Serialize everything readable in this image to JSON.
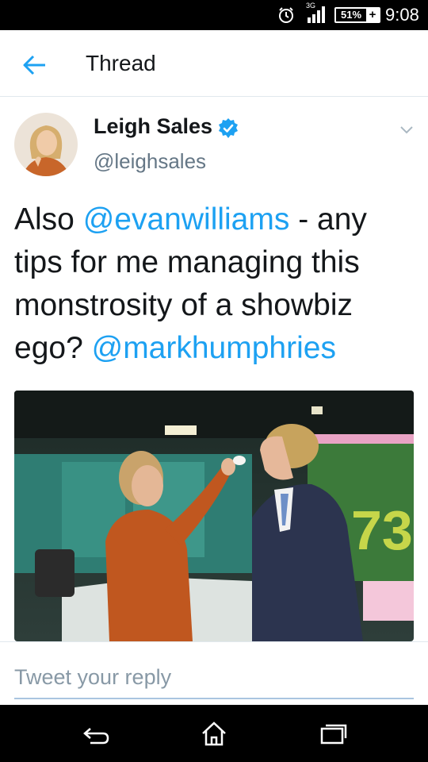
{
  "status_bar": {
    "network": "3G",
    "battery": "51%",
    "time": "9:08",
    "icons": [
      "alarm-icon",
      "signal-icon",
      "battery-icon",
      "charging-icon"
    ]
  },
  "header": {
    "title": "Thread",
    "back_icon": "back-arrow-icon"
  },
  "tweet": {
    "author_name": "Leigh Sales",
    "author_handle": "@leighsales",
    "verified": true,
    "text_parts": [
      {
        "type": "text",
        "value": "Also "
      },
      {
        "type": "mention",
        "value": "@evanwilliams"
      },
      {
        "type": "text",
        "value": " - any tips for me managing this monstrosity of a showbiz ego? "
      },
      {
        "type": "mention",
        "value": "@markhumphries"
      }
    ],
    "media_overlay_text": "73"
  },
  "reply": {
    "placeholder": "Tweet your reply"
  },
  "nav_bar": {
    "buttons": [
      "back-icon",
      "home-icon",
      "recents-icon"
    ]
  },
  "colors": {
    "accent": "#1da1f2",
    "text": "#14171a",
    "secondary": "#657786",
    "status_bar": "#000000"
  }
}
